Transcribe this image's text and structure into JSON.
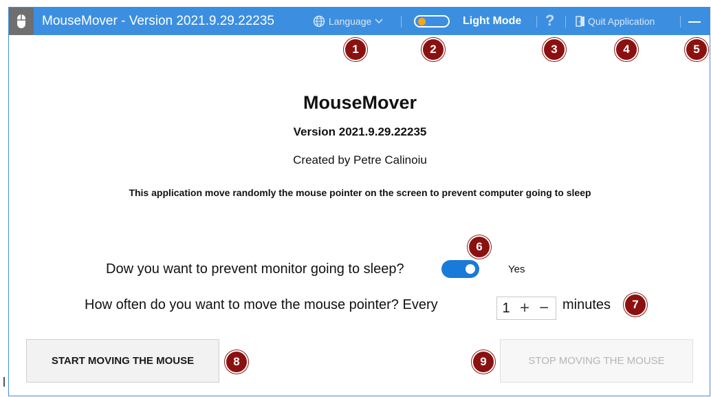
{
  "titlebar": {
    "title": "MouseMover - Version 2021.9.29.22235",
    "language_label": "Language",
    "mode_label": "Light Mode",
    "help_label": "?",
    "quit_label": "Quit Application",
    "accent_color": "#3c8fe0"
  },
  "main": {
    "app_name": "MouseMover",
    "version": "Version 2021.9.29.22235",
    "author": "Created by Petre Calinoiu",
    "description": "This application move randomly the mouse pointer on the screen to prevent computer going to sleep"
  },
  "settings": {
    "monitor_question": "Dow you want to prevent monitor going to sleep?",
    "monitor_toggle_state": "on",
    "monitor_toggle_label": "Yes",
    "interval_question": "How often do you want to move the mouse pointer? Every",
    "interval_value": "1",
    "plus_symbol": "+",
    "minus_symbol": "−",
    "interval_unit": "minutes"
  },
  "buttons": {
    "start_label": "START MOVING THE MOUSE",
    "stop_label": "STOP MOVING THE MOUSE",
    "stop_enabled": false
  },
  "badges": [
    "1",
    "2",
    "3",
    "4",
    "5",
    "6",
    "7",
    "8",
    "9"
  ],
  "badge_color": "#8b1111"
}
